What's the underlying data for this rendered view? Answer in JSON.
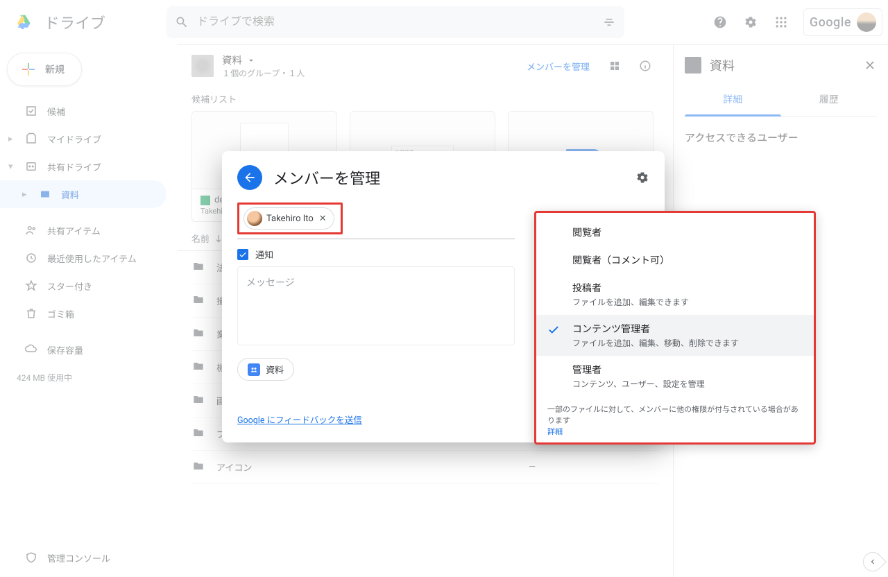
{
  "header": {
    "product": "ドライブ",
    "search_placeholder": "ドライブで検索",
    "google": "Google"
  },
  "sidebar": {
    "new_label": "新規",
    "items": [
      {
        "label": "候補"
      },
      {
        "label": "マイドライブ"
      },
      {
        "label": "共有ドライブ"
      },
      {
        "label": "資料"
      },
      {
        "label": "共有アイテム"
      },
      {
        "label": "最近使用したアイテム"
      },
      {
        "label": "スター付き"
      },
      {
        "label": "ゴミ箱"
      },
      {
        "label": "保存容量"
      },
      {
        "label": "管理コンソール"
      }
    ],
    "storage_used": "424 MB 使用中"
  },
  "shared_drive": {
    "title": "資料",
    "subtitle": "１個のグループ・１人",
    "manage_link": "メンバーを管理"
  },
  "suggestions": {
    "label": "候補リスト",
    "cards": [
      {
        "title": "de",
        "sub": "Takehiro"
      },
      {
        "title": "",
        "sub": ""
      },
      {
        "title": "",
        "sub": ""
      }
    ]
  },
  "list": {
    "name_header": "名前",
    "folders": [
      {
        "name": "法",
        "modified": "—"
      },
      {
        "name": "撮",
        "modified": "—"
      },
      {
        "name": "業",
        "modified": "—"
      },
      {
        "name": "機",
        "modified": "—"
      },
      {
        "name": "画像庫",
        "modified": "—"
      },
      {
        "name": "プログラムテンプレート",
        "modified": "—"
      },
      {
        "name": "アイコン",
        "modified": "—"
      }
    ]
  },
  "details": {
    "title": "資料",
    "tab_detail": "詳細",
    "tab_history": "履歴",
    "access_label": "アクセスできるユーザー"
  },
  "dialog": {
    "title": "メンバーを管理",
    "chip_name": "Takehiro Ito",
    "notify": "通知",
    "message_placeholder": "メッセージ",
    "source": "資料",
    "feedback": "Google にフィードバックを送信"
  },
  "roles": {
    "options": [
      {
        "label": "閲覧者",
        "desc": ""
      },
      {
        "label": "閲覧者（コメント可）",
        "desc": ""
      },
      {
        "label": "投稿者",
        "desc": "ファイルを追加、編集できます"
      },
      {
        "label": "コンテンツ管理者",
        "desc": "ファイルを追加、編集、移動、削除できます",
        "selected": true
      },
      {
        "label": "管理者",
        "desc": "コンテンツ、ユーザー、設定を管理"
      }
    ],
    "footnote": "一部のファイルに対して、メンバーに他の権限が付与されている場合があります",
    "footlink": "詳細"
  }
}
